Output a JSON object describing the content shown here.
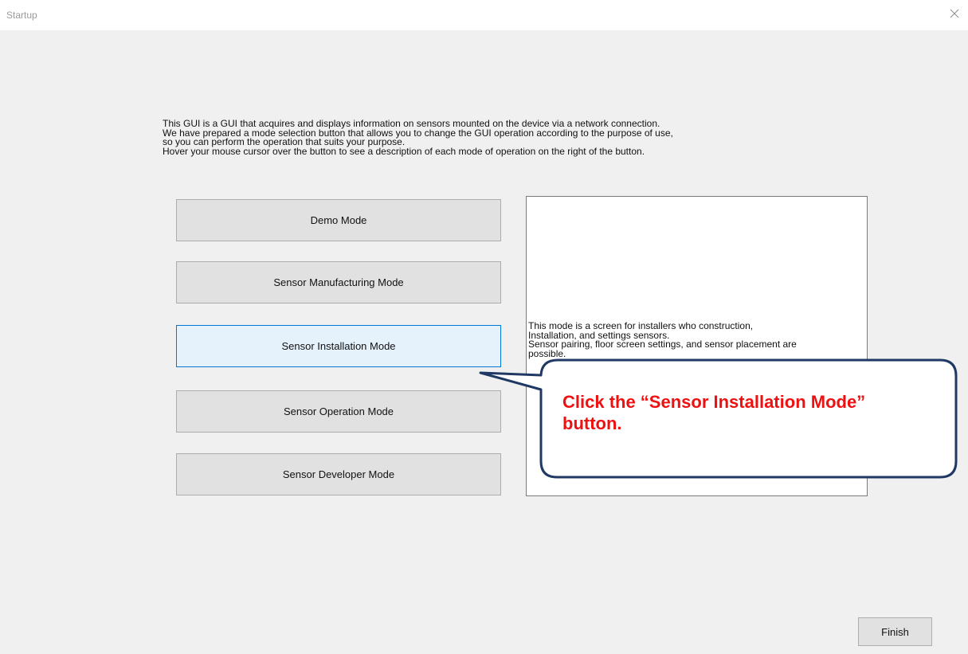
{
  "window": {
    "title": "Startup",
    "close_icon": "close-icon"
  },
  "intro": {
    "text": "This GUI is a GUI that acquires and displays information on sensors mounted on the device via a network connection.\nWe have prepared a mode selection button that allows you to change the GUI operation according to the purpose of use,\nso you can perform the operation that suits your purpose.\nHover your mouse cursor over the button to see a description of each mode of operation on the right of the button."
  },
  "modes": {
    "demo": "Demo Mode",
    "manufacturing": "Sensor Manufacturing Mode",
    "installation": "Sensor Installation Mode",
    "operation": "Sensor Operation Mode",
    "developer": "Sensor Developer Mode",
    "hovered": "Sensor Installation Mode"
  },
  "description": {
    "text": "This mode is a screen for installers who construction,\nInstallation, and settings sensors.\nSensor pairing, floor screen settings, and sensor placement are\npossible."
  },
  "callout": {
    "text": "Click the “Sensor Installation Mode” button.",
    "text_color": "#ee1111",
    "border_color": "#1f3864"
  },
  "footer": {
    "finish_label": "Finish"
  },
  "colors": {
    "window_bg": "#f0f0f0",
    "button_bg": "#e1e1e1",
    "button_hover_bg": "#e5f1fb",
    "button_hover_border": "#0078d7"
  }
}
